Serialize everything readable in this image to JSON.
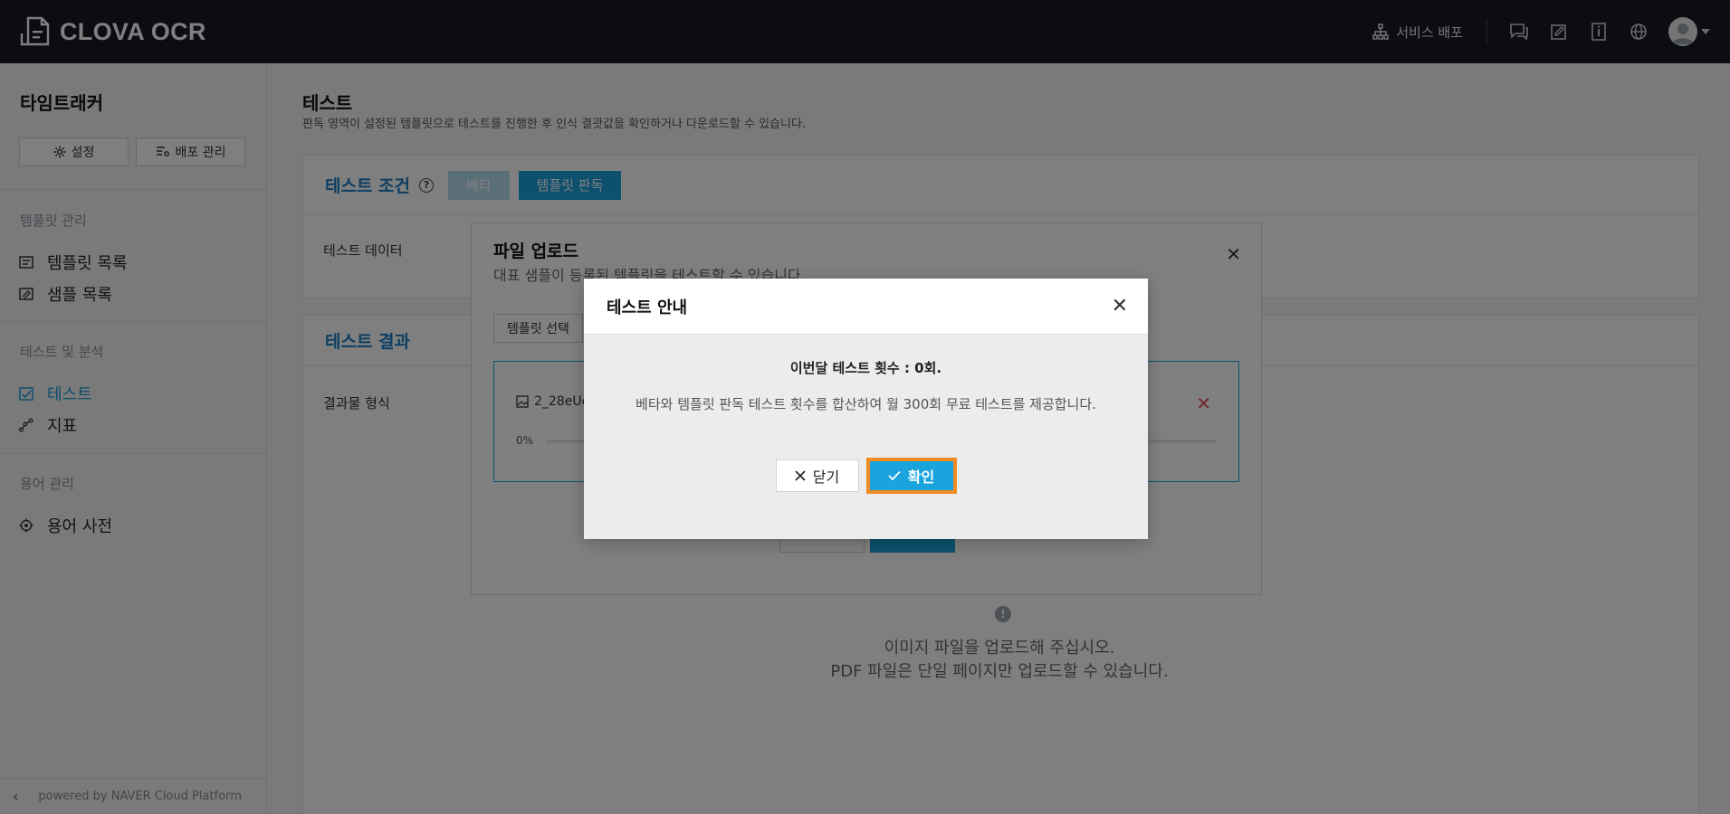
{
  "header": {
    "brand": "CLOVA OCR",
    "deploy_label": "서비스 배포"
  },
  "sidebar": {
    "project_title": "타임트래커",
    "settings_label": "설정",
    "deploy_manage_label": "배포 관리",
    "sections": [
      {
        "title": "템플릿 관리",
        "items": [
          "템플릿 목록",
          "샘플 목록"
        ]
      },
      {
        "title": "테스트 및 분석",
        "items": [
          "테스트",
          "지표"
        ]
      },
      {
        "title": "용어 관리",
        "items": [
          "용어 사전"
        ]
      }
    ],
    "active_item": "테스트",
    "footer": "powered by NAVER Cloud Platform"
  },
  "main": {
    "title": "테스트",
    "description": "판독 영역이 설정된 템플릿으로 테스트를 진행한 후 인식 결괏값을 확인하거나 다운로드할 수 있습니다.",
    "conditions_title": "테스트 조건",
    "beta_label": "베타",
    "template_read_label": "템플릿 판독",
    "test_data_label": "테스트 데이터",
    "results_title": "테스트 결과",
    "result_format_label": "결과물 형식",
    "empty_line1": "이미지 파일을 업로드해 주십시오.",
    "empty_line2": "PDF 파일은 단일 페이지만 업로드할 수 있습니다."
  },
  "upload_dialog": {
    "title": "파일 업로드",
    "description": "대표 샘플이 등록된 템플릿을 테스트할 수 있습니다.",
    "template_select_label": "템플릿 선택",
    "file_name": "2_28eUc",
    "progress": "0%"
  },
  "modal": {
    "title": "테스트 안내",
    "line1": "이번달 테스트 횟수 : 0회.",
    "line2": "베타와 템플릿 판독 테스트 횟수를 합산하여 월 300회 무료 테스트를 제공합니다.",
    "close_label": "닫기",
    "confirm_label": "확인"
  },
  "colors": {
    "topbar": "#161b26",
    "accent": "#1aa3dd",
    "focus_ring": "#f08a24"
  }
}
